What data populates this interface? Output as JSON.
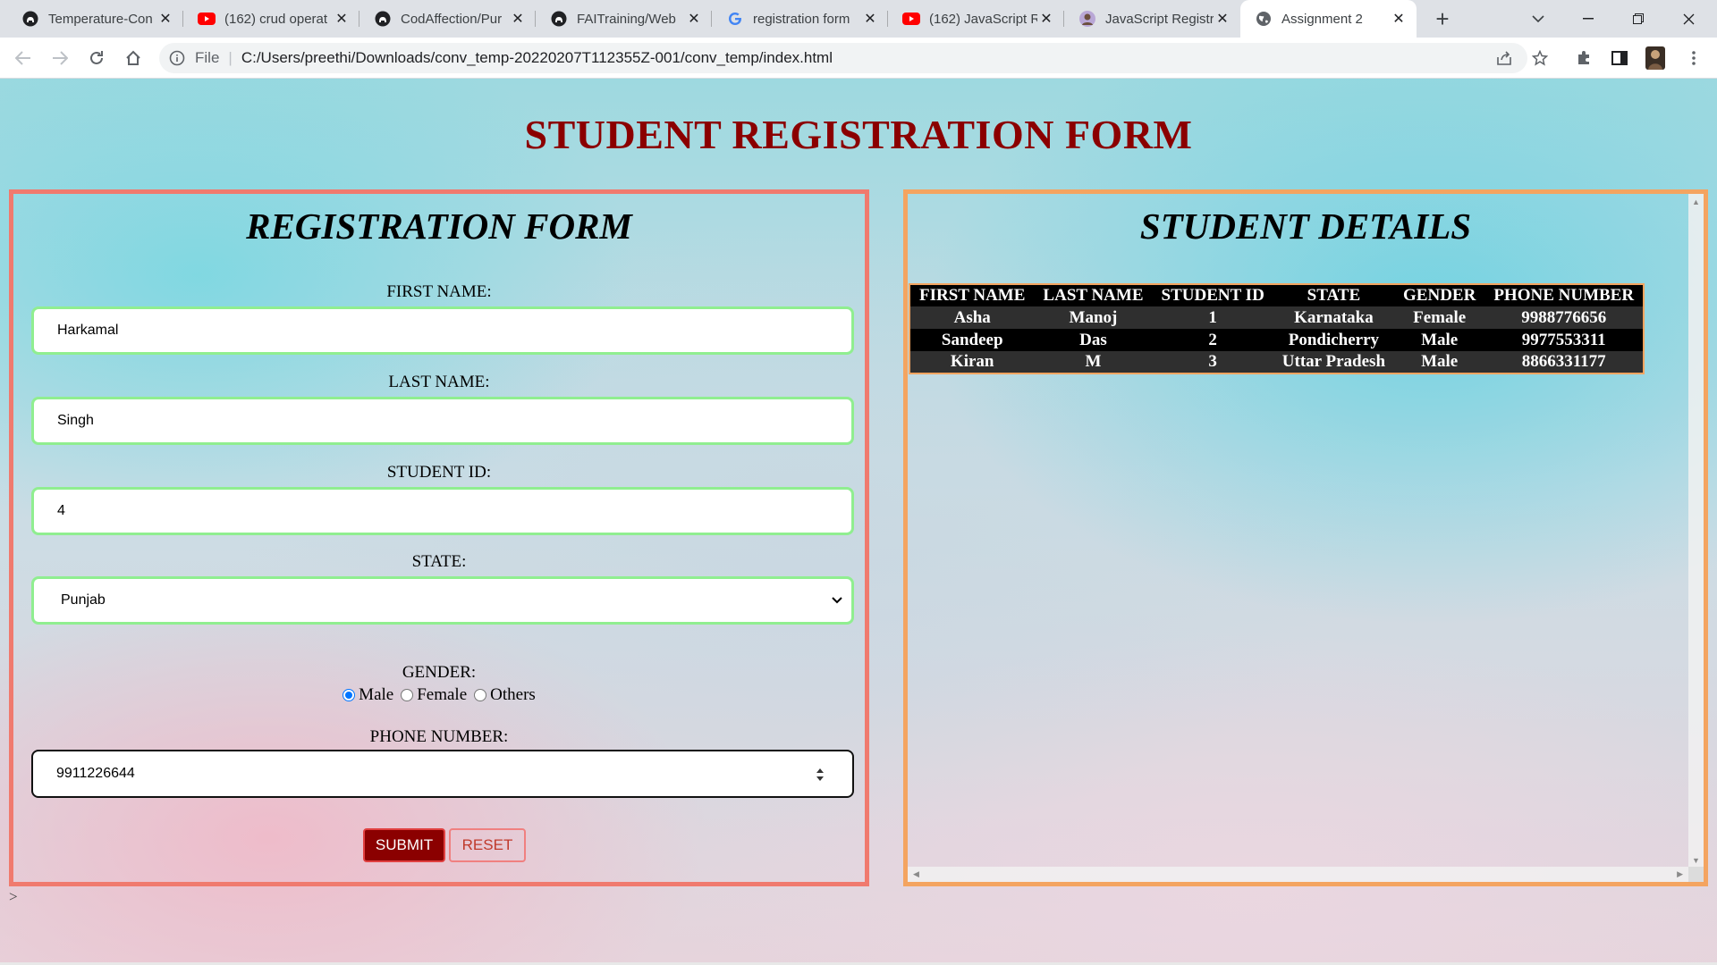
{
  "browser": {
    "tabs": [
      {
        "title": "Temperature-Con",
        "icon": "github-icon"
      },
      {
        "title": "(162) crud operat",
        "icon": "youtube-icon"
      },
      {
        "title": "CodAffection/Pur",
        "icon": "github-icon"
      },
      {
        "title": "FAITraining/Web",
        "icon": "github-icon"
      },
      {
        "title": "registration form",
        "icon": "google-icon"
      },
      {
        "title": "(162) JavaScript R",
        "icon": "youtube-icon"
      },
      {
        "title": "JavaScript Registr",
        "icon": "avatar-icon"
      },
      {
        "title": "Assignment 2",
        "icon": "globe-icon",
        "active": true
      }
    ],
    "address": {
      "scheme": "File",
      "url": "C:/Users/preethi/Downloads/conv_temp-20220207T112355Z-001/conv_temp/index.html"
    }
  },
  "page": {
    "title": "STUDENT REGISTRATION FORM",
    "stray_text": ">"
  },
  "form": {
    "title": "REGISTRATION FORM",
    "first_name": {
      "label": "FIRST NAME:",
      "value": "Harkamal"
    },
    "last_name": {
      "label": "LAST NAME:",
      "value": "Singh"
    },
    "student_id": {
      "label": "STUDENT ID:",
      "value": "4"
    },
    "state": {
      "label": "STATE:",
      "value": "Punjab"
    },
    "gender": {
      "label": "GENDER:",
      "options": [
        {
          "label": "Male",
          "checked": true
        },
        {
          "label": "Female",
          "checked": false
        },
        {
          "label": "Others",
          "checked": false
        }
      ]
    },
    "phone": {
      "label": "PHONE NUMBER:",
      "value": "9911226644"
    },
    "submit_label": "SUBMIT",
    "reset_label": "RESET"
  },
  "details": {
    "title": "STUDENT DETAILS",
    "columns": [
      "FIRST NAME",
      "LAST NAME",
      "STUDENT ID",
      "STATE",
      "GENDER",
      "PHONE NUMBER"
    ],
    "rows": [
      [
        "Asha",
        "Manoj",
        "1",
        "Karnataka",
        "Female",
        "9988776656"
      ],
      [
        "Sandeep",
        "Das",
        "2",
        "Pondicherry",
        "Male",
        "9977553311"
      ],
      [
        "Kiran",
        "M",
        "3",
        "Uttar Pradesh",
        "Male",
        "8866331177"
      ]
    ]
  },
  "colors": {
    "title": "#8b0000",
    "form_border": "#f07a6e",
    "details_border": "#f4a460",
    "input_border": "#90ee90",
    "submit_bg": "#8b0000"
  }
}
